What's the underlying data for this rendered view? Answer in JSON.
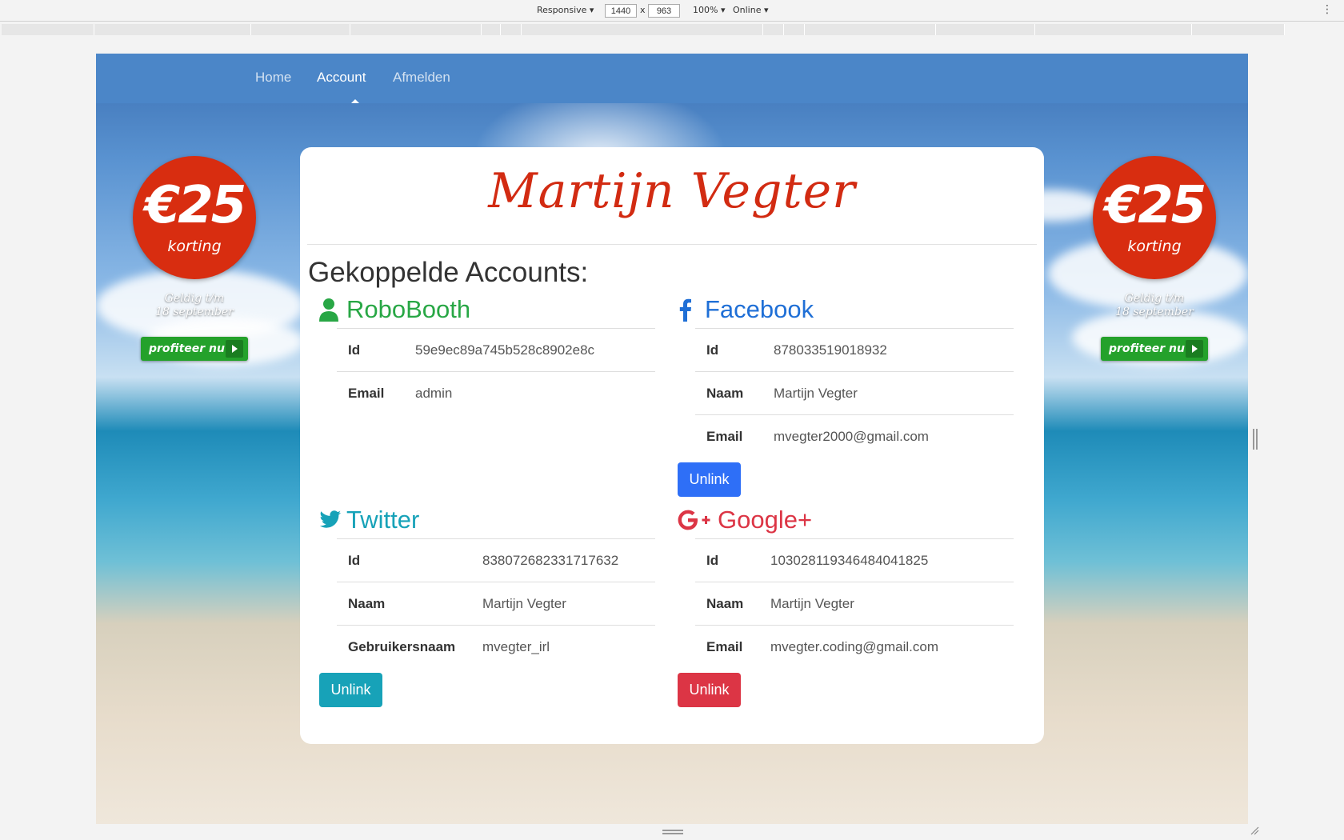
{
  "devtools": {
    "device": "Responsive",
    "width": "1440",
    "height": "963",
    "times": "x",
    "zoom": "100%",
    "network": "Online"
  },
  "nav": {
    "items": [
      {
        "label": "Home",
        "active": false
      },
      {
        "label": "Account",
        "active": true
      },
      {
        "label": "Afmelden",
        "active": false
      }
    ]
  },
  "promo": {
    "amount": "€25",
    "sub": "korting",
    "valid_line1": "Geldig t/m",
    "valid_line2": "18 september",
    "button": "profiteer nu"
  },
  "card": {
    "title": "Martijn Vegter",
    "heading": "Gekoppelde Accounts:"
  },
  "accounts": {
    "robobooth": {
      "name": "RoboBooth",
      "icon": "user-icon",
      "color": "#28a745",
      "rows": [
        {
          "label": "Id",
          "value": "59e9ec89a745b528c8902e8c"
        },
        {
          "label": "Email",
          "value": "admin"
        }
      ]
    },
    "facebook": {
      "name": "Facebook",
      "icon": "facebook-icon",
      "color": "#1f6fd6",
      "rows": [
        {
          "label": "Id",
          "value": "878033519018932"
        },
        {
          "label": "Naam",
          "value": "Martijn Vegter"
        },
        {
          "label": "Email",
          "value": "mvegter2000@gmail.com"
        }
      ],
      "button": "Unlink",
      "button_color": "#2e6ff7"
    },
    "twitter": {
      "name": "Twitter",
      "icon": "twitter-icon",
      "color": "#17a2b8",
      "rows": [
        {
          "label": "Id",
          "value": "838072682331717632"
        },
        {
          "label": "Naam",
          "value": "Martijn Vegter"
        },
        {
          "label": "Gebruikersnaam",
          "value": "mvegter_irl"
        }
      ],
      "button": "Unlink",
      "button_color": "#17a2b8"
    },
    "google": {
      "name": "Google+",
      "icon": "google-plus-icon",
      "color": "#dc3545",
      "rows": [
        {
          "label": "Id",
          "value": "103028119346484041825"
        },
        {
          "label": "Naam",
          "value": "Martijn Vegter"
        },
        {
          "label": "Email",
          "value": "mvegter.coding@gmail.com"
        }
      ],
      "button": "Unlink",
      "button_color": "#dc3545"
    }
  }
}
